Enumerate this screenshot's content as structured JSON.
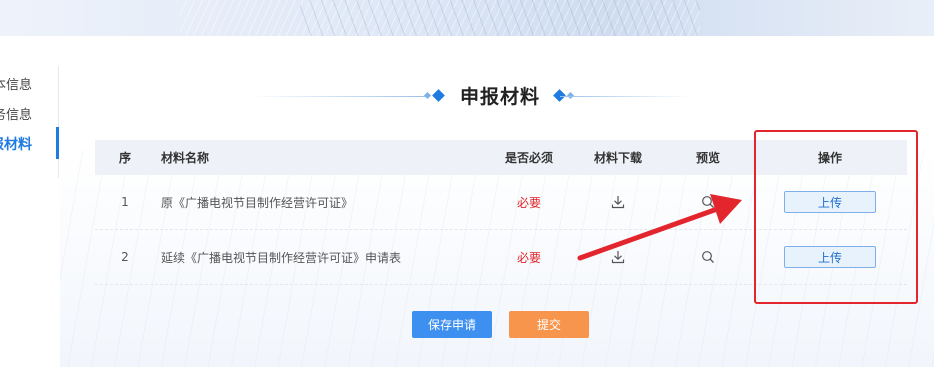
{
  "side_nav": {
    "items": [
      {
        "label": "基本信息"
      },
      {
        "label": "业务信息"
      },
      {
        "label": "申报材料"
      }
    ]
  },
  "section": {
    "title": "申报材料"
  },
  "table": {
    "headers": {
      "no": "序",
      "name": "材料名称",
      "required": "是否必须",
      "download": "材料下载",
      "preview": "预览",
      "operation": "操作"
    },
    "rows": [
      {
        "no": "1",
        "name": "原《广播电视节目制作经营许可证》",
        "required": "必要",
        "upload_label": "上传"
      },
      {
        "no": "2",
        "name": "延续《广播电视节目制作经营许可证》申请表",
        "required": "必要",
        "upload_label": "上传"
      }
    ]
  },
  "actions": {
    "save_label": "保存申请",
    "submit_label": "提交"
  },
  "colors": {
    "accent": "#1f7be0",
    "required": "#e0262b",
    "save": "#3d8ff0",
    "submit": "#f7954d",
    "annotation": "#e3262e"
  },
  "icons": {
    "download": "download-icon",
    "preview": "search-icon"
  }
}
